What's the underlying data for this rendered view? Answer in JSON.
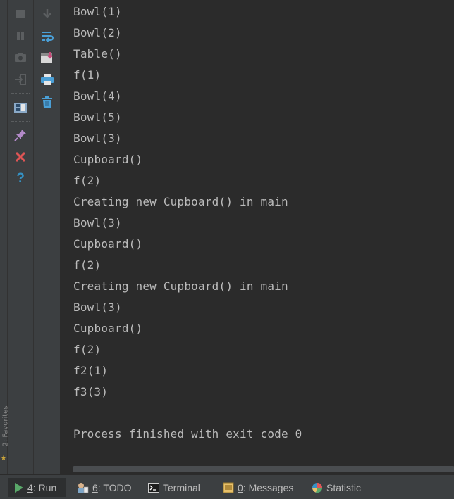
{
  "sidebar": {
    "favorites_label": "2: Favorites"
  },
  "console": {
    "lines": [
      "Bowl(1)",
      "Bowl(2)",
      "Table()",
      "f(1)",
      "Bowl(4)",
      "Bowl(5)",
      "Bowl(3)",
      "Cupboard()",
      "f(2)",
      "Creating new Cupboard() in main",
      "Bowl(3)",
      "Cupboard()",
      "f(2)",
      "Creating new Cupboard() in main",
      "Bowl(3)",
      "Cupboard()",
      "f(2)",
      "f2(1)",
      "f3(3)",
      "",
      "Process finished with exit code 0"
    ]
  },
  "bottom_tabs": [
    {
      "num": "4",
      "label": ": Run",
      "icon": "run-triangle-icon",
      "active": true
    },
    {
      "num": "6",
      "label": ": TODO",
      "icon": "todo-icon",
      "active": false
    },
    {
      "num": "",
      "label": "Terminal",
      "icon": "terminal-icon",
      "active": false
    },
    {
      "num": "0",
      "label": ": Messages",
      "icon": "messages-icon",
      "active": false
    },
    {
      "num": "",
      "label": "Statistic",
      "icon": "statistic-icon",
      "active": false
    }
  ],
  "colors": {
    "panel_bg": "#3c3f41",
    "console_bg": "#2b2b2b",
    "console_text": "#bbbbbb",
    "run_green": "#59a869",
    "close_red": "#e05555",
    "help_blue": "#3592c4"
  }
}
